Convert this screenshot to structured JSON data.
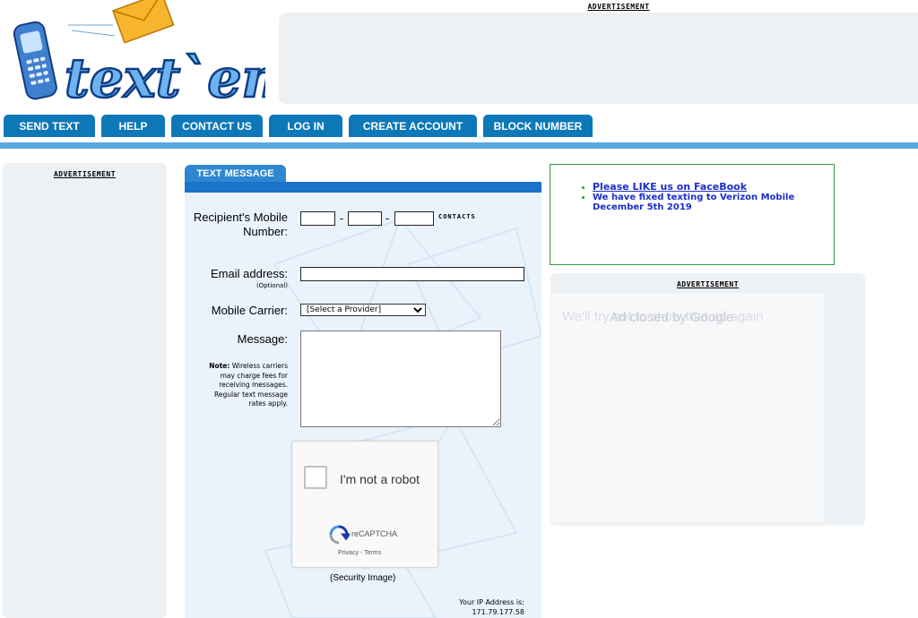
{
  "logo": {
    "text": "text`em"
  },
  "ads": {
    "label": "ADVERTISEMENT",
    "right_overlay_text": "We'll try not to show that ad again",
    "right_closed_text": "Ad closed by Google"
  },
  "nav": {
    "items": [
      {
        "label": "SEND TEXT"
      },
      {
        "label": "HELP"
      },
      {
        "label": "CONTACT US"
      },
      {
        "label": "LOG IN"
      },
      {
        "label": "CREATE ACCOUNT"
      },
      {
        "label": "BLOCK NUMBER"
      }
    ]
  },
  "form": {
    "tab_label": "TEXT MESSAGE",
    "recipient_label": "Recipient's Mobile Number:",
    "separator": "-",
    "contacts_label": "CONTACTS",
    "email_label": "Email address:",
    "email_optional": "(Optional)",
    "carrier_label": "Mobile Carrier:",
    "carrier_selected": "[Select a Provider]",
    "message_label": "Message:",
    "note_bold": "Note:",
    "note_text": "Wireless carriers may charge fees for receiving messages. Regular text message rates apply.",
    "captcha_label": "I'm not a robot",
    "captcha_brand": "reCAPTCHA",
    "captcha_links": "Privacy - Terms",
    "security_image": "(Security Image)",
    "ip_label": "Your IP Address is:",
    "ip_value": "171.79.177.58"
  },
  "news": {
    "items": [
      {
        "text": "Please LIKE us on FaceBook",
        "link": true
      },
      {
        "text": "We have fixed texting to Verizon Mobile December 5th 2019",
        "link": false
      }
    ]
  },
  "colors": {
    "nav": "#0d78b8",
    "nav_line": "#5aa8e0",
    "tab": "#2f87d0",
    "news_border": "#2f9b3a",
    "news_text": "#1a2ec9"
  }
}
